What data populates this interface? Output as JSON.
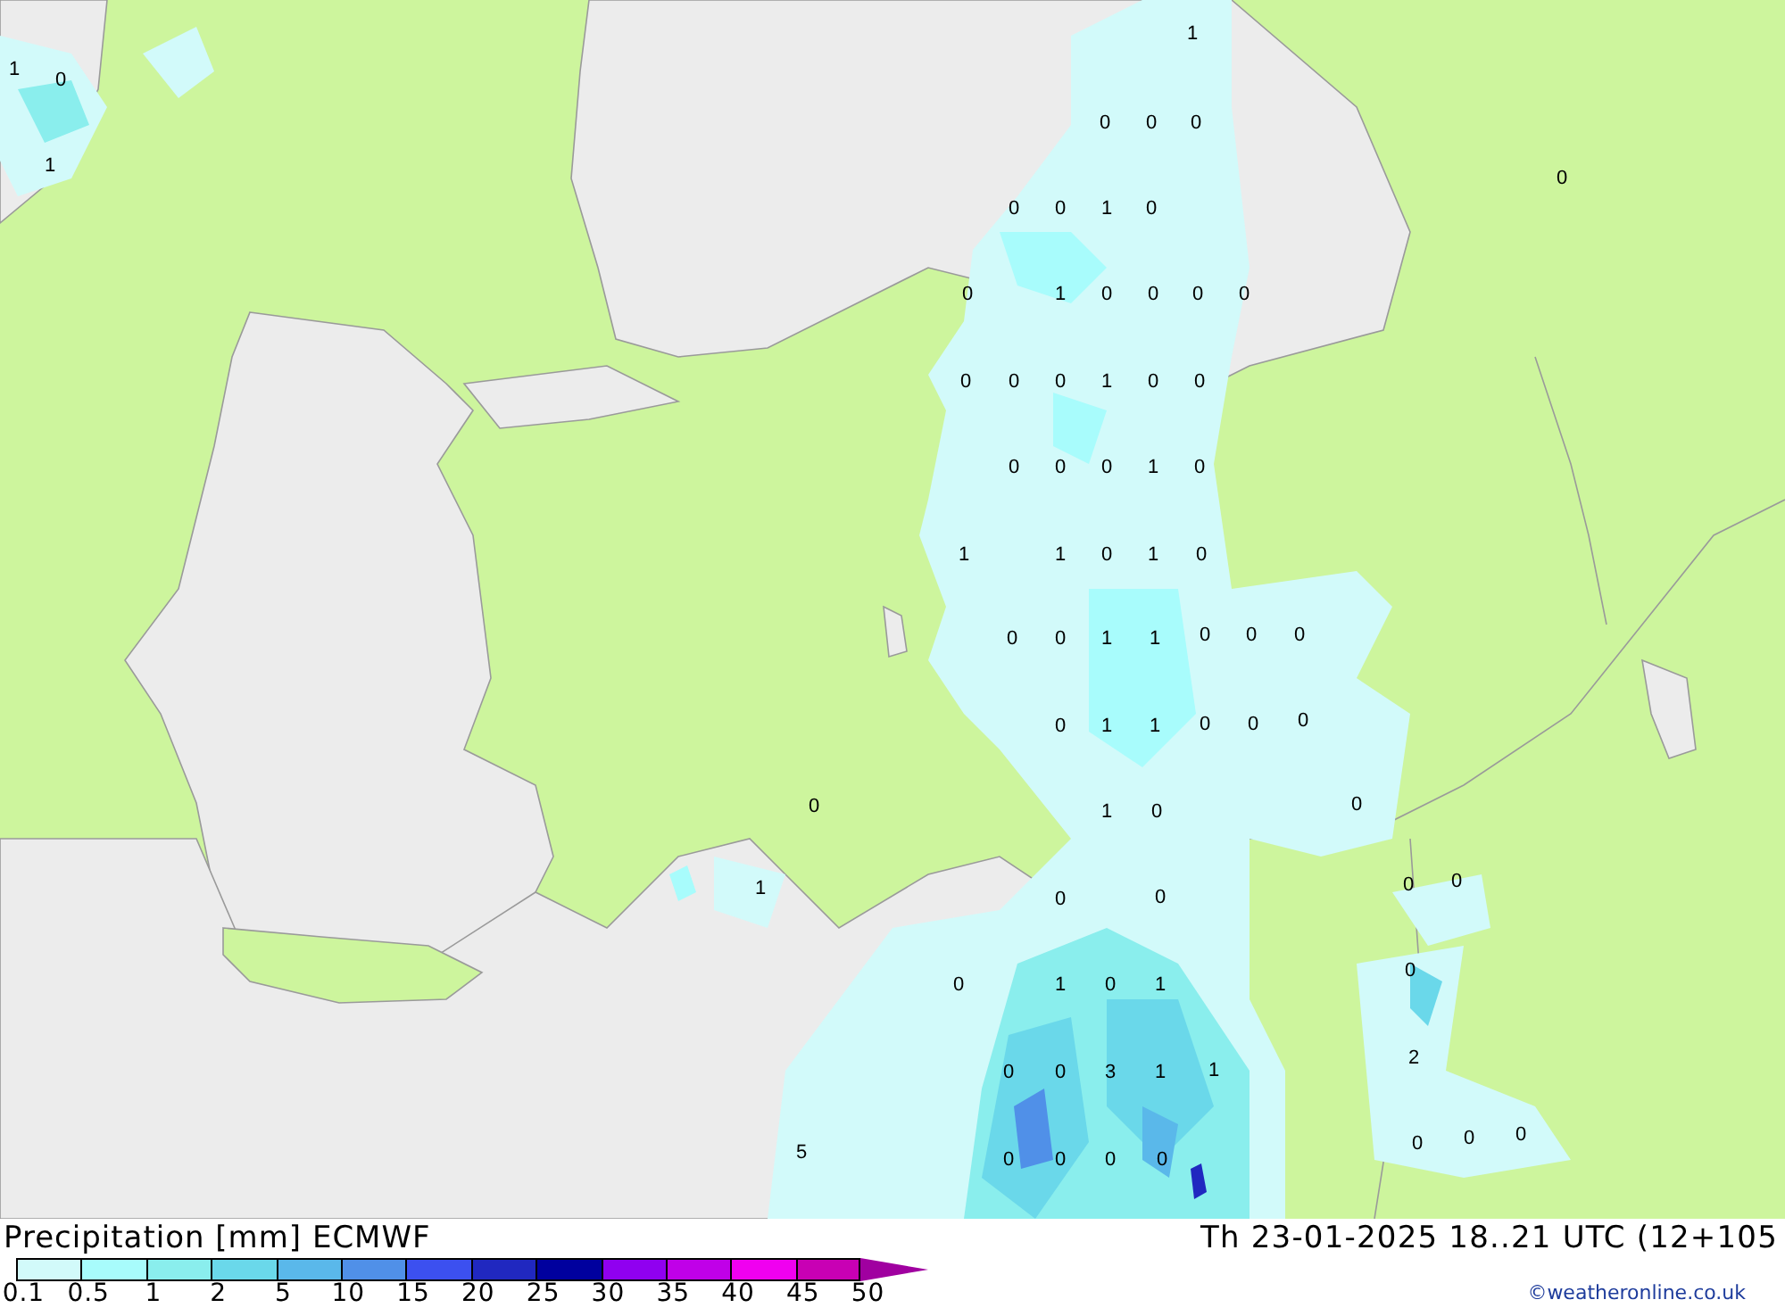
{
  "map": {
    "labels": [
      "1",
      "1",
      "0",
      "0",
      "0",
      "0",
      "1",
      "0",
      "0",
      "0",
      "1",
      "0",
      "0",
      "1",
      "0",
      "0",
      "0",
      "0",
      "0",
      "0",
      "0",
      "1",
      "0",
      "0",
      "0",
      "0",
      "0",
      "1",
      "0",
      "1",
      "1",
      "0",
      "1",
      "0",
      "0",
      "0",
      "1",
      "1",
      "0",
      "0",
      "0",
      "0",
      "1",
      "1",
      "0",
      "0",
      "0",
      "0",
      "1",
      "0",
      "0",
      "0",
      "0",
      "1",
      "0",
      "0",
      "0",
      "0",
      "1",
      "0",
      "1",
      "2",
      "0",
      "0",
      "3",
      "1",
      "1",
      "0",
      "0",
      "0",
      "5",
      "0",
      "0",
      "0",
      "0"
    ]
  },
  "legend": {
    "title": "Precipitation [mm] ECMWF",
    "valid_time": "Th 23-01-2025 18..21 UTC (12+105",
    "swatches": [
      {
        "color": "#d2fafa"
      },
      {
        "color": "#a8fcfc"
      },
      {
        "color": "#8aeeed"
      },
      {
        "color": "#6ad8ea"
      },
      {
        "color": "#5ab8ea"
      },
      {
        "color": "#5090e8"
      },
      {
        "color": "#3c50f0"
      },
      {
        "color": "#2028c0"
      },
      {
        "color": "#00009e"
      },
      {
        "color": "#9000f0"
      },
      {
        "color": "#c000e8"
      },
      {
        "color": "#f000f0"
      },
      {
        "color": "#c800b4"
      }
    ],
    "arrow": {
      "color": "#a000a0"
    },
    "ticks": [
      "0.1",
      "0.5",
      "1",
      "2",
      "5",
      "10",
      "15",
      "20",
      "25",
      "30",
      "35",
      "40",
      "45",
      "50"
    ]
  },
  "credit": "©weatheronline.co.uk"
}
